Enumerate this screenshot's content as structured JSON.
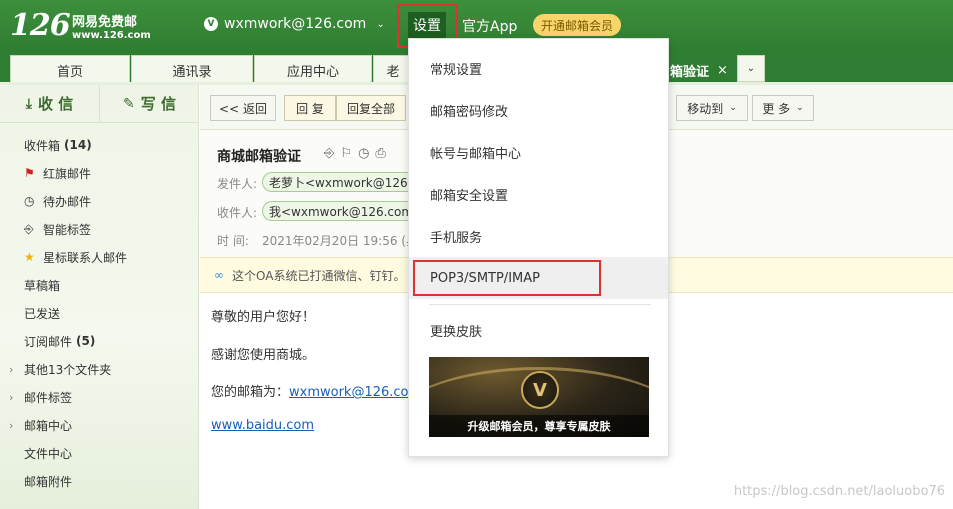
{
  "header": {
    "logo_num": "126",
    "logo_name": "网易免费邮",
    "logo_domain": "www.126.com",
    "vip_letter": "V",
    "account": "wxmwork@126.com",
    "settings": "设置",
    "app_link": "官方App",
    "vip_button": "开通邮箱会员"
  },
  "tabs": [
    {
      "label": "首页"
    },
    {
      "label": "通讯录"
    },
    {
      "label": "应用中心"
    },
    {
      "label": "老"
    },
    {
      "label": "箱验证",
      "close": "×"
    }
  ],
  "tab_dropdown_icon": "chevron-down",
  "sidebar": {
    "receive": "收 信",
    "write": "写 信",
    "folders": [
      {
        "label": "收件箱",
        "count": "(14)"
      },
      {
        "label": "红旗邮件",
        "icon": "flag-icon"
      },
      {
        "label": "待办邮件",
        "icon": "clock-icon"
      },
      {
        "label": "智能标签",
        "icon": "bookmark-icon"
      },
      {
        "label": "星标联系人邮件",
        "icon": "star-icon"
      },
      {
        "label": "草稿箱"
      },
      {
        "label": "已发送"
      },
      {
        "label": "订阅邮件",
        "count": "(5)"
      },
      {
        "label": "其他13个文件夹",
        "expand": "›"
      },
      {
        "label": "邮件标签",
        "expand": "›"
      },
      {
        "label": "邮箱中心",
        "expand": "›"
      },
      {
        "label": "文件中心"
      },
      {
        "label": "邮箱附件"
      }
    ]
  },
  "toolbar": {
    "back": "<< 返回",
    "reply": "回 复",
    "reply_all": "回复全部",
    "move_to": "移动到",
    "more": "更 多"
  },
  "mail": {
    "subject": "商城邮箱验证",
    "from_label": "发件人:",
    "from": "老萝卜<wxmwork@126.co",
    "to_label": "收件人:",
    "to": "我<wxmwork@126.com",
    "time_label": "时  间:",
    "time": "2021年02月20日 19:56 (星",
    "notice": "这个OA系统已打通微信、钉钉。",
    "greeting": "尊敬的用户您好！",
    "thanks": "感谢您使用商城。",
    "email_prefix": "您的邮箱为：",
    "email_link": "wxmwork@126.co",
    "site_link": "www.baidu.com"
  },
  "settings_menu": {
    "items": [
      "常规设置",
      "邮箱密码修改",
      "帐号与邮箱中心",
      "邮箱安全设置",
      "手机服务",
      "POP3/SMTP/IMAP"
    ],
    "skin": "更换皮肤",
    "banner_letter": "V",
    "banner_caption": "升级邮箱会员，尊享专属皮肤"
  },
  "watermark": "https://blog.csdn.net/laoluobo76",
  "colors": {
    "header_green": "#2f7d32",
    "highlight_red": "#e03030",
    "vip_yellow": "#f7d56a",
    "link_blue": "#1a5fb4"
  }
}
